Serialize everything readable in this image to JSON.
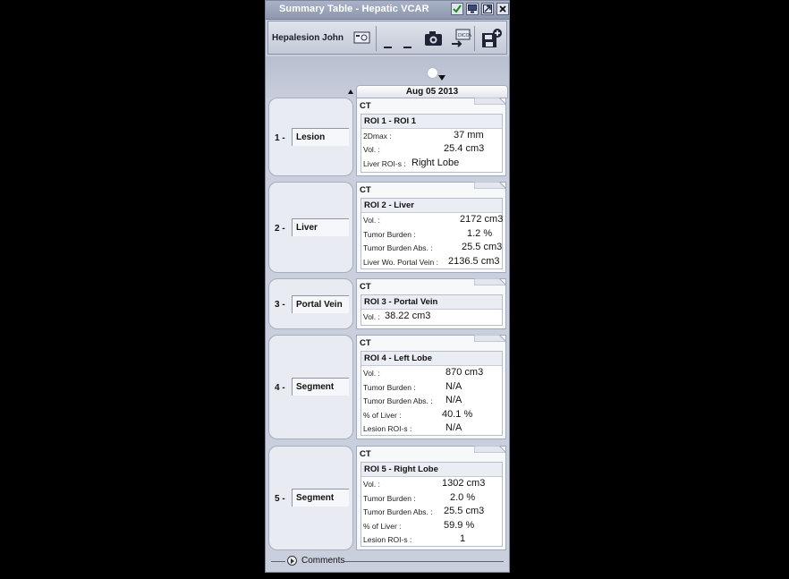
{
  "window": {
    "title": "Summary Table - Hepatic VCAR"
  },
  "toolbar": {
    "patient_name": "Hepalesion John"
  },
  "date_column": {
    "label": "Aug 05 2013"
  },
  "rows": [
    {
      "num": "1 -",
      "label": "Lesion",
      "modality": "CT",
      "roi_title": "ROI 1 - ROI 1",
      "fields": [
        {
          "name": "2Dmax :",
          "value": "37 mm"
        },
        {
          "name": "Vol. :",
          "value": "25.4 cm3"
        },
        {
          "name": "Liver ROI-s :",
          "value": "Right Lobe"
        }
      ]
    },
    {
      "num": "2 -",
      "label": "Liver",
      "modality": "CT",
      "roi_title": "ROI 2 - Liver",
      "fields": [
        {
          "name": "Vol. :",
          "value": "2172 cm3"
        },
        {
          "name": "Tumor Burden :",
          "value": "1.2 %"
        },
        {
          "name": "Tumor Burden Abs. :",
          "value": "25.5 cm3"
        },
        {
          "name": "Liver Wo. Portal Vein :",
          "value": "2136.5 cm3"
        }
      ]
    },
    {
      "num": "3 -",
      "label": "Portal Vein",
      "modality": "CT",
      "roi_title": "ROI 3 - Portal Vein",
      "fields": [
        {
          "name": "Vol. :",
          "value": "38.22 cm3"
        }
      ]
    },
    {
      "num": "4 -",
      "label": "Segment",
      "modality": "CT",
      "roi_title": "ROI 4 - Left Lobe",
      "fields": [
        {
          "name": "Vol. :",
          "value": "870 cm3"
        },
        {
          "name": "Tumor Burden :",
          "value": "N/A"
        },
        {
          "name": "Tumor Burden Abs. :",
          "value": "N/A"
        },
        {
          "name": "% of Liver :",
          "value": "40.1 %"
        },
        {
          "name": "Lesion ROI-s :",
          "value": "N/A"
        }
      ]
    },
    {
      "num": "5 -",
      "label": "Segment",
      "modality": "CT",
      "roi_title": "ROI 5 - Right Lobe",
      "fields": [
        {
          "name": "Vol. :",
          "value": "1302 cm3"
        },
        {
          "name": "Tumor Burden :",
          "value": "2.0 %"
        },
        {
          "name": "Tumor Burden Abs. :",
          "value": "25.5 cm3"
        },
        {
          "name": "% of Liver :",
          "value": "59.9 %"
        },
        {
          "name": "Lesion ROI-s :",
          "value": "1"
        }
      ]
    }
  ],
  "footer": {
    "comments_label": "Comments"
  }
}
